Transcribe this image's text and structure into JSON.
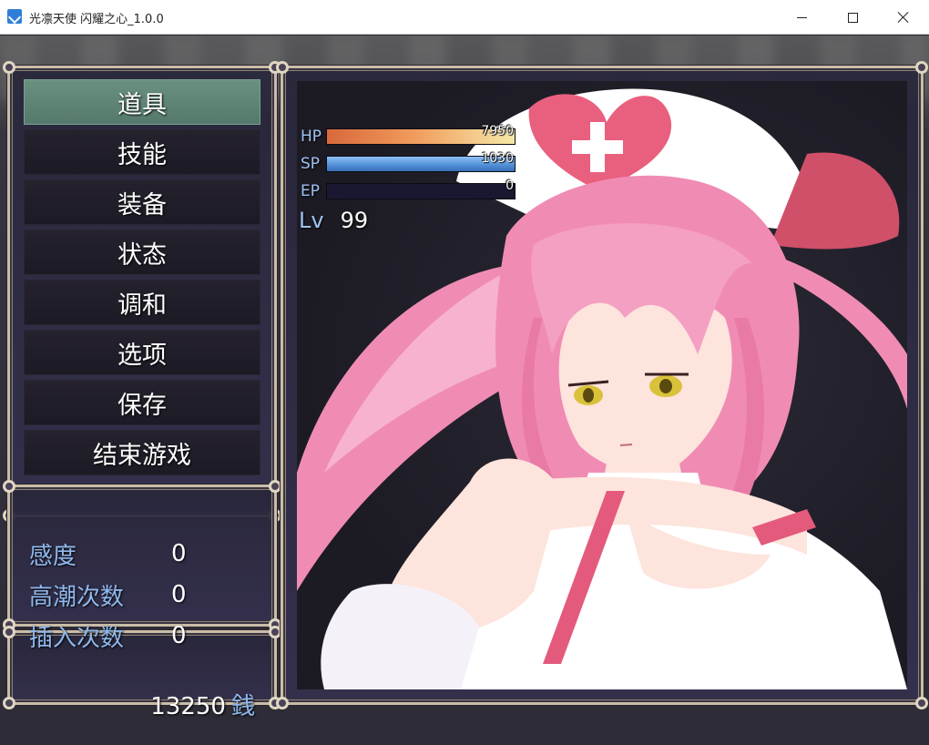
{
  "window": {
    "title": "光凛天使 闪耀之心_1.0.0"
  },
  "menu": {
    "items": [
      {
        "label": "道具",
        "selected": true
      },
      {
        "label": "技能",
        "selected": false
      },
      {
        "label": "装备",
        "selected": false
      },
      {
        "label": "状态",
        "selected": false
      },
      {
        "label": "调和",
        "selected": false
      },
      {
        "label": "选项",
        "selected": false
      },
      {
        "label": "保存",
        "selected": false
      },
      {
        "label": "结束游戏",
        "selected": false
      }
    ]
  },
  "stats": {
    "rows": [
      {
        "label": "感度",
        "value": "0"
      },
      {
        "label": "高潮次数",
        "value": "0"
      },
      {
        "label": "插入次数",
        "value": "0"
      }
    ]
  },
  "gold": {
    "amount": "13250",
    "unit": "銭"
  },
  "character": {
    "gauges": [
      {
        "label": "HP",
        "value": "7950",
        "fill": 1.0,
        "kind": "hp"
      },
      {
        "label": "SP",
        "value": "1030",
        "fill": 1.0,
        "kind": "sp"
      },
      {
        "label": "EP",
        "value": "0",
        "fill": 0.0,
        "kind": "ep"
      }
    ],
    "level_label": "Lv",
    "level": "99"
  },
  "colors": {
    "selected_item": "#5f8777",
    "system_text": "#8fb8ec",
    "frame": "#c9bda6",
    "hair": "#f08cb4",
    "outfit": "#ffffff"
  }
}
